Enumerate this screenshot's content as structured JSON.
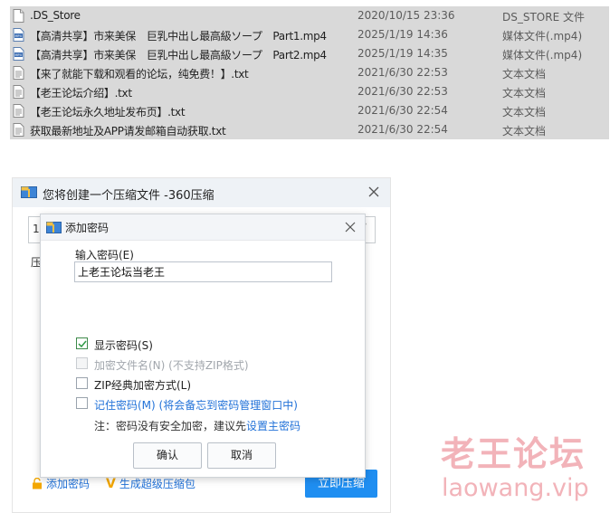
{
  "files": [
    {
      "name": ".DS_Store",
      "date": "2020/10/15 23:36",
      "type": "DS_STORE 文件",
      "icon": "blank-file-icon"
    },
    {
      "name": "【高清共享】市来美保　巨乳中出し最高級ソープ　Part1.mp4",
      "date": "2025/1/19 14:36",
      "type": "媒体文件(.mp4)",
      "icon": "mp4-file-icon"
    },
    {
      "name": "【高清共享】市来美保　巨乳中出し最高級ソープ　Part2.mp4",
      "date": "2025/1/19 14:35",
      "type": "媒体文件(.mp4)",
      "icon": "mp4-file-icon"
    },
    {
      "name": "【来了就能下载和观看的论坛，纯免费！】.txt",
      "date": "2021/6/30 22:53",
      "type": "文本文档",
      "icon": "text-file-icon"
    },
    {
      "name": "【老王论坛介绍】.txt",
      "date": "2021/6/30 22:53",
      "type": "文本文档",
      "icon": "text-file-icon"
    },
    {
      "name": "【老王论坛永久地址发布页】.txt",
      "date": "2021/6/30 22:54",
      "type": "文本文档",
      "icon": "text-file-icon"
    },
    {
      "name": "获取最新地址及APP请发邮箱自动获取.txt",
      "date": "2021/6/30 22:54",
      "type": "文本文档",
      "icon": "text-file-icon"
    }
  ],
  "main_dialog": {
    "title": "您将创建一个压缩文件 -360压缩",
    "field_prefix": "1",
    "label_prefix": "压",
    "add_password_link": "添加密码",
    "super_compress_link": "生成超级压缩包",
    "compress_button": "立即压缩"
  },
  "password_dialog": {
    "title": "添加密码",
    "input_label": "输入密码(E)",
    "password_value": "上老王论坛当老王",
    "options": {
      "show_password": {
        "label": "显示密码(S)",
        "checked": true
      },
      "encrypt_filenames": {
        "label": "加密文件名(N) (不支持ZIP格式)",
        "checked": false,
        "disabled": true
      },
      "zip_classic": {
        "label": "ZIP经典加密方式(L)",
        "checked": false
      },
      "remember_password": {
        "label": "记住密码(M) (将会备忘到密码管理窗口中)",
        "checked": false
      }
    },
    "note_text": "注：密码没有安全加密，建议先",
    "note_link": "设置主密码",
    "ok_button": "确认",
    "cancel_button": "取消"
  },
  "watermark": {
    "chinese": "老王论坛",
    "url": "laowang.vip"
  },
  "colors": {
    "accent": "#1f8ef1",
    "link": "#2272d8",
    "row_bg": "#d9d9d9",
    "watermark": "#f2b3b9"
  }
}
